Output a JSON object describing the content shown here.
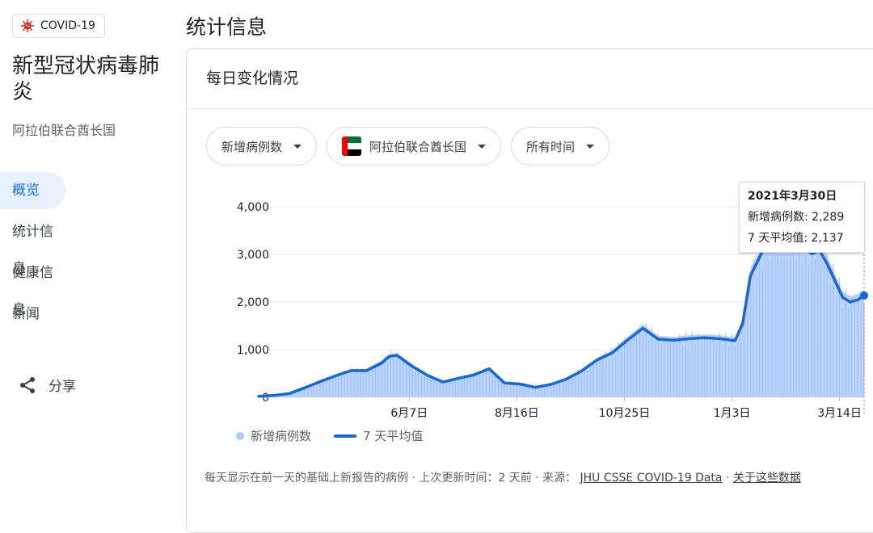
{
  "covid_chip": {
    "label": "COVID-19",
    "icon": "virus-icon",
    "icon_color": "#d93025"
  },
  "sidebar": {
    "title": "新型冠状病毒肺炎",
    "subtitle": "阿拉伯联合酋长国",
    "nav": [
      {
        "label": "概览",
        "active": true
      },
      {
        "label": "统计信息",
        "active": false
      },
      {
        "label": "健康信息",
        "active": false
      },
      {
        "label": "新闻",
        "active": false
      }
    ],
    "share_label": "分享"
  },
  "main": {
    "section_title": "统计信息",
    "card_title": "每日变化情况",
    "filters": {
      "metric": "新增病例数",
      "region": "阿拉伯联合酋长国",
      "time": "所有时间"
    },
    "tooltip": {
      "date": "2021年3月30日",
      "cases": "新增病例数: 2,289",
      "avg": "7 天平均值: 2,137"
    },
    "legend": {
      "bars": "新增病例数",
      "line": "7 天平均值"
    },
    "footer": {
      "text": "每天显示在前一天的基础上新报告的病例 · 上次更新时间：2 天前 · 来源：",
      "source_link": "JHU CSSE COVID-19 Data",
      "about_link": "关于这些数据"
    }
  },
  "colors": {
    "accent": "#1a73e8",
    "line": "#1967d2",
    "bars": "#aecbfa"
  },
  "chart_data": {
    "type": "area",
    "title": "每日变化情况",
    "x_tick_labels": [
      "6月7日",
      "8月16日",
      "10月25日",
      "1月3日",
      "3月14日"
    ],
    "x_ticks_day_index": [
      98,
      168,
      238,
      308,
      378
    ],
    "x_range_day_index": [
      0,
      394
    ],
    "ylim": [
      0,
      4000
    ],
    "yticks": [
      0,
      1000,
      2000,
      3000,
      4000
    ],
    "ytick_labels": [
      "0",
      "1,000",
      "2,000",
      "3,000",
      "4,000"
    ],
    "grid": true,
    "legend_position": "bottom-left",
    "series": [
      {
        "name": "7 天平均值",
        "x_day_index": [
          0,
          10,
          20,
          30,
          40,
          50,
          60,
          70,
          80,
          85,
          90,
          100,
          110,
          120,
          130,
          140,
          150,
          160,
          170,
          180,
          190,
          200,
          210,
          220,
          230,
          240,
          250,
          260,
          270,
          280,
          290,
          300,
          310,
          315,
          320,
          330,
          340,
          350,
          360,
          365,
          370,
          380,
          385,
          390,
          394
        ],
        "y": [
          20,
          40,
          80,
          200,
          330,
          450,
          560,
          560,
          720,
          860,
          880,
          650,
          460,
          320,
          400,
          470,
          600,
          300,
          280,
          210,
          270,
          380,
          550,
          780,
          930,
          1200,
          1450,
          1220,
          1200,
          1230,
          1250,
          1230,
          1190,
          1550,
          2550,
          3200,
          3320,
          3250,
          3010,
          3080,
          2800,
          2100,
          2000,
          2050,
          2137
        ]
      }
    ],
    "highlighted_point": {
      "date": "2021年3月30日",
      "new_cases": 2289,
      "seven_day_avg": 2137
    }
  }
}
